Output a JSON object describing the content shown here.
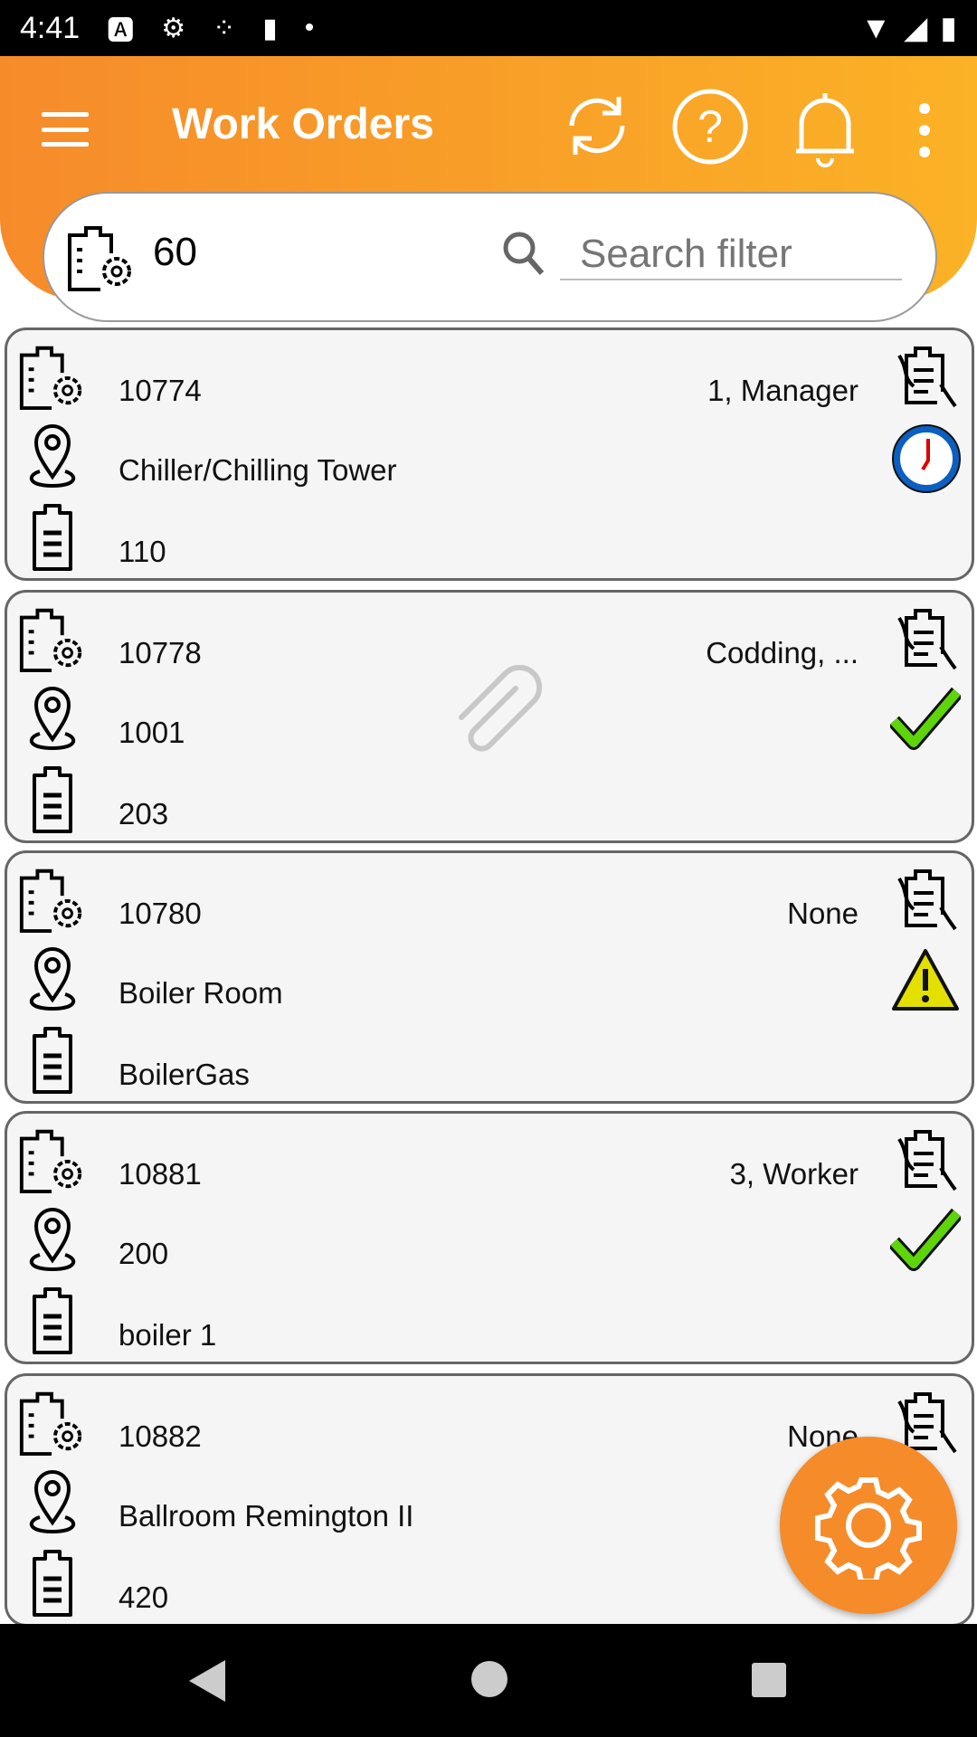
{
  "status_bar": {
    "time": "4:41",
    "icons": [
      "a-icon",
      "gear-icon",
      "assistant-icon",
      "sd-card-icon",
      "dot-icon"
    ],
    "right_icons": [
      "wifi-icon",
      "signal-icon",
      "battery-icon"
    ]
  },
  "header": {
    "title": "Work Orders",
    "actions": [
      "sync-icon",
      "help-icon",
      "bell-icon",
      "more-vert-icon"
    ]
  },
  "search": {
    "count": "60",
    "placeholder": "Search filter"
  },
  "colors": {
    "accent": "#f68b2a",
    "accent_end": "#fbb226",
    "clock_ring": "#0a5fc0",
    "check": "#5ed40a",
    "warning": "#e3e000"
  },
  "work_orders": [
    {
      "id": "10774",
      "assignee": "1, Manager",
      "location": "Chiller/Chilling Tower",
      "asset": "110",
      "status_icon": "clock-icon",
      "attachment": false
    },
    {
      "id": "10778",
      "assignee": "Codding, ...",
      "location": "1001",
      "asset": "203",
      "status_icon": "check-icon",
      "attachment": true
    },
    {
      "id": "10780",
      "assignee": "None",
      "location": "Boiler Room",
      "asset": "BoilerGas",
      "status_icon": "warning-icon",
      "attachment": false
    },
    {
      "id": "10881",
      "assignee": "3, Worker",
      "location": "200",
      "asset": "boiler 1",
      "status_icon": "check-icon",
      "attachment": false
    },
    {
      "id": "10882",
      "assignee": "None",
      "location": "Ballroom Remington II",
      "asset": "420",
      "status_icon": "",
      "attachment": false
    }
  ],
  "fab": {
    "icon": "gear-icon"
  },
  "nav": {
    "buttons": [
      "back",
      "home",
      "recents"
    ]
  }
}
